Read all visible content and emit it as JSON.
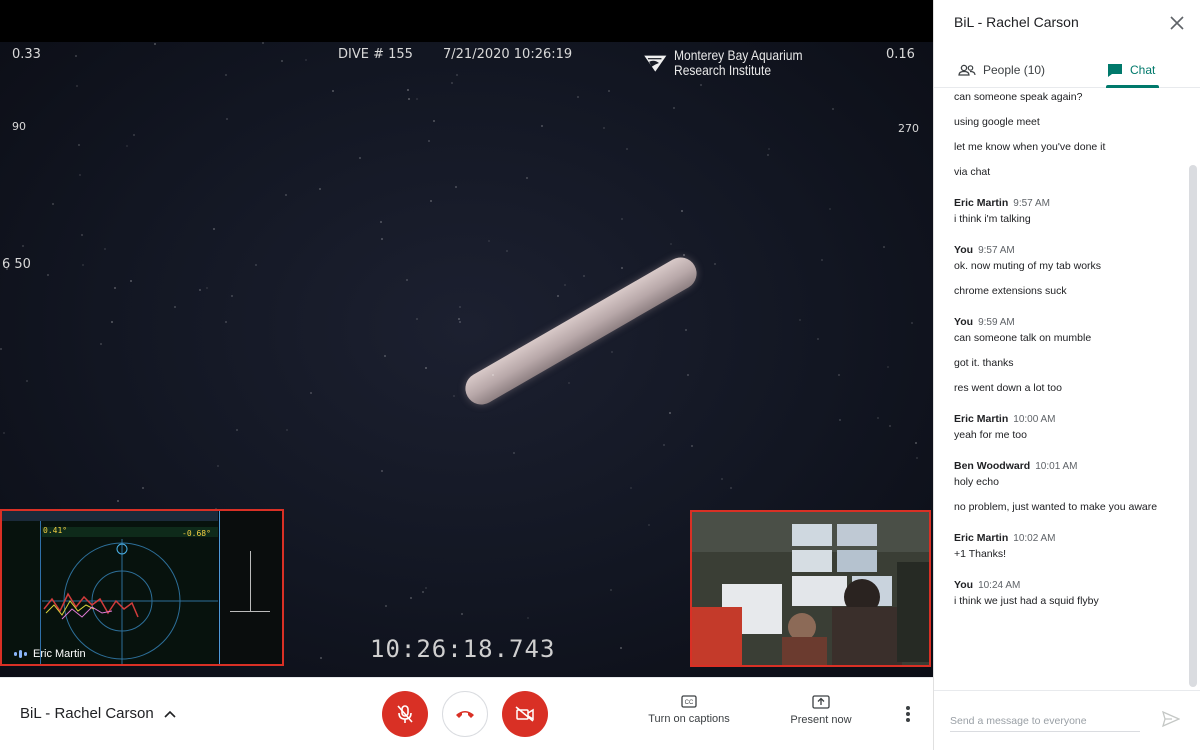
{
  "video": {
    "depth_left_top": "0.33",
    "dive_label": "DIVE # 155",
    "datetime": "7/21/2020 10:26:19",
    "org_name_line1": "Monterey Bay Aquarium",
    "org_name_line2": "Research Institute",
    "value_right_top": "0.16",
    "heading_left": "90",
    "heading_right": "270",
    "left_scale": "6 50",
    "timecode": "10:26:18.743"
  },
  "tiles": {
    "left_participant": "Eric Martin",
    "nav_readout_1": "0.41°",
    "nav_readout_2": "-0.68°"
  },
  "bottom_bar": {
    "meeting_title": "BiL - Rachel Carson",
    "captions_label": "Turn on captions",
    "present_label": "Present now"
  },
  "panel": {
    "title": "BiL - Rachel Carson",
    "people_tab": "People (10)",
    "chat_tab": "Chat",
    "compose_placeholder": "Send a message to everyone",
    "messages": [
      {
        "kind": "line",
        "text": "can someone speak again?"
      },
      {
        "kind": "line",
        "text": "using google meet"
      },
      {
        "kind": "line",
        "text": "let me know when you've done it"
      },
      {
        "kind": "line",
        "text": "via chat"
      },
      {
        "kind": "head",
        "sender": "Eric Martin",
        "time": "9:57 AM"
      },
      {
        "kind": "line",
        "text": "i think i'm talking"
      },
      {
        "kind": "head",
        "sender": "You",
        "time": "9:57 AM"
      },
      {
        "kind": "line",
        "text": "ok. now muting of my tab works"
      },
      {
        "kind": "line",
        "text": "chrome extensions suck"
      },
      {
        "kind": "head",
        "sender": "You",
        "time": "9:59 AM"
      },
      {
        "kind": "line",
        "text": "can someone talk on mumble"
      },
      {
        "kind": "line",
        "text": "got it. thanks"
      },
      {
        "kind": "line",
        "text": "res went down a lot too"
      },
      {
        "kind": "head",
        "sender": "Eric Martin",
        "time": "10:00 AM"
      },
      {
        "kind": "line",
        "text": "yeah for me too"
      },
      {
        "kind": "head",
        "sender": "Ben Woodward",
        "time": "10:01 AM"
      },
      {
        "kind": "line",
        "text": "holy echo"
      },
      {
        "kind": "line",
        "text": "no problem, just wanted to make you aware"
      },
      {
        "kind": "head",
        "sender": "Eric Martin",
        "time": "10:02 AM"
      },
      {
        "kind": "line",
        "text": "+1 Thanks!"
      },
      {
        "kind": "head",
        "sender": "You",
        "time": "10:24 AM"
      },
      {
        "kind": "line",
        "text": "i think we just had a squid flyby"
      }
    ]
  },
  "colors": {
    "danger_red": "#d93025",
    "chat_accent": "#00796b"
  }
}
